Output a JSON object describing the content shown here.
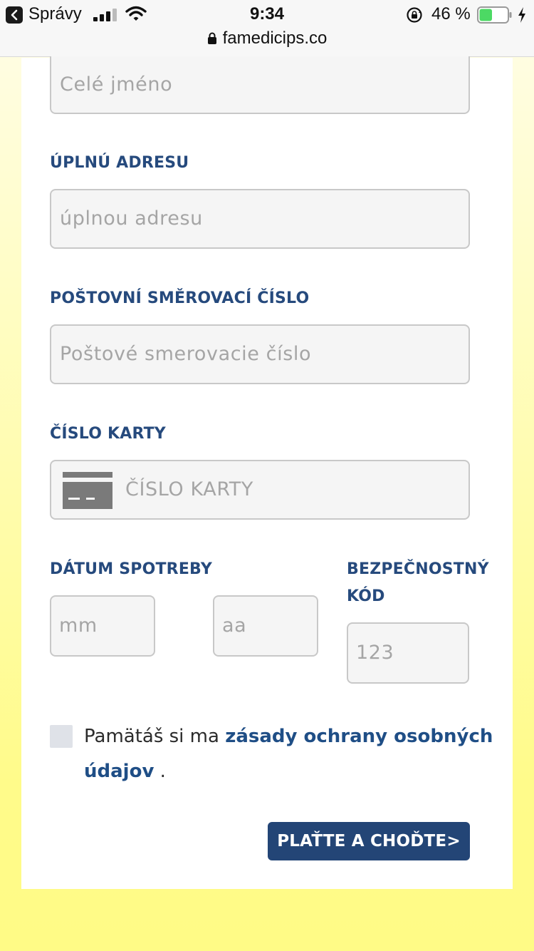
{
  "status_bar": {
    "back_app": "Správy",
    "time": "9:34",
    "battery_percent": "46 %",
    "battery_level": 0.46,
    "url": "famedicips.co"
  },
  "form": {
    "full_name": {
      "placeholder": "Celé jméno"
    },
    "address": {
      "label": "ÚPLNÚ ADRESU",
      "placeholder": "úplnou adresu"
    },
    "postal_code": {
      "label": "POŠTOVNÍ SMĚROVACÍ ČÍSLO",
      "placeholder": "Poštové smerovacie číslo"
    },
    "card_number": {
      "label": "ČÍSLO KARTY",
      "placeholder": "ČÍSLO KARTY"
    },
    "expiry": {
      "label": "DÁTUM SPOTREBY",
      "month_placeholder": "mm",
      "year_placeholder": "aa"
    },
    "security_code": {
      "label_line1": "BEZPEČNOSTNÝ",
      "label_line2": "KÓD",
      "placeholder": "123"
    },
    "consent": {
      "prefix": "Pamätáš si ma ",
      "link": "zásady ochrany osobných údajov",
      "suffix": " ."
    },
    "submit_label": "PLAŤTE A CHOĎTE>"
  },
  "icons": {
    "back": "chevron-left-icon",
    "signal": "cell-signal-icon",
    "wifi": "wifi-icon",
    "rotation_lock": "rotation-lock-icon",
    "battery": "battery-icon",
    "charging": "charging-bolt-icon",
    "url_lock": "lock-icon",
    "card": "credit-card-icon"
  },
  "colors": {
    "label": "#264a7d",
    "link": "#1f4e86",
    "button": "#234576",
    "battery_fill": "#4cd964",
    "page_background": "#fffb86"
  }
}
